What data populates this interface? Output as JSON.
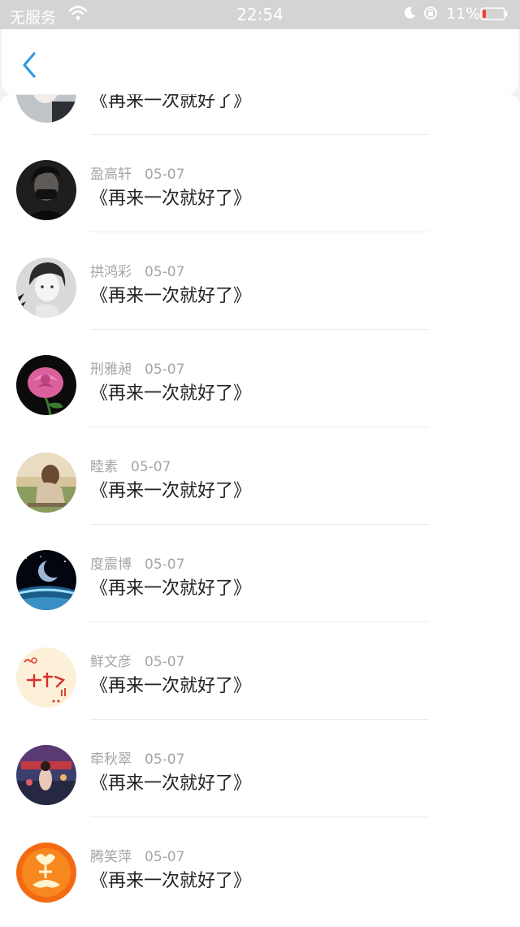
{
  "status_bar": {
    "carrier": "无服务",
    "time": "22:54",
    "battery": "11%"
  },
  "nav": {
    "back_icon": "chevron-left-icon",
    "accent": "#2e9be3"
  },
  "comments": [
    {
      "name": "",
      "date": "",
      "text": "《再来一次就好了》",
      "avatar": "avatar-portrait-light"
    },
    {
      "name": "盈高轩",
      "date": "05-07",
      "text": "《再来一次就好了》",
      "avatar": "avatar-portrait-dark"
    },
    {
      "name": "拱鸿彩",
      "date": "05-07",
      "text": "《再来一次就好了》",
      "avatar": "avatar-portrait-bw"
    },
    {
      "name": "刑雅昶",
      "date": "05-07",
      "text": "《再来一次就好了》",
      "avatar": "avatar-rose"
    },
    {
      "name": "睦素",
      "date": "05-07",
      "text": "《再来一次就好了》",
      "avatar": "avatar-girl-field"
    },
    {
      "name": "度震博",
      "date": "05-07",
      "text": "《再来一次就好了》",
      "avatar": "avatar-planet"
    },
    {
      "name": "鲜文彦",
      "date": "05-07",
      "text": "《再来一次就好了》",
      "avatar": "avatar-cartoon-text"
    },
    {
      "name": "牵秋翠",
      "date": "05-07",
      "text": "《再来一次就好了》",
      "avatar": "avatar-stage"
    },
    {
      "name": "腾笑萍",
      "date": "05-07",
      "text": "《再来一次就好了》",
      "avatar": "avatar-orange-emblem"
    }
  ]
}
